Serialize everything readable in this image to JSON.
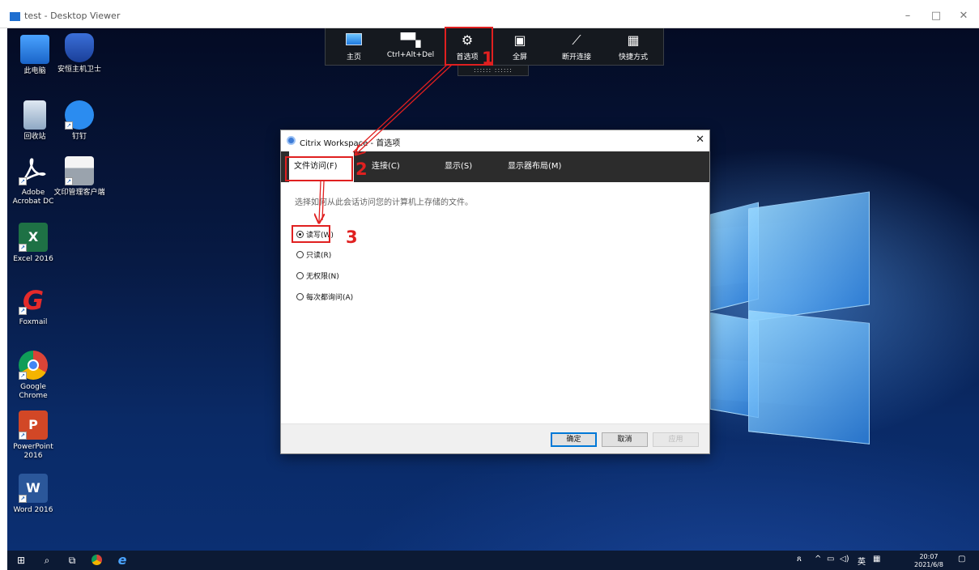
{
  "window": {
    "title": "test - Desktop Viewer",
    "controls": [
      "–",
      "□",
      "✕"
    ]
  },
  "desktop": {
    "icons": [
      {
        "label": "此电脑",
        "icon": "computer-icon"
      },
      {
        "label": "安恒主机卫士",
        "icon": "shield-icon"
      },
      {
        "label": "回收站",
        "icon": "recycle-bin-icon"
      },
      {
        "label": "钉钉",
        "icon": "dingtalk-icon"
      },
      {
        "label": "Adobe Acrobat DC",
        "icon": "acrobat-icon"
      },
      {
        "label": "文印管理客户端",
        "icon": "printer-icon"
      },
      {
        "label": "Excel 2016",
        "icon": "excel-icon"
      },
      {
        "label": "Foxmail",
        "icon": "foxmail-icon"
      },
      {
        "label": "Google Chrome",
        "icon": "chrome-icon"
      },
      {
        "label": "PowerPoint 2016",
        "icon": "powerpoint-icon"
      },
      {
        "label": "Word 2016",
        "icon": "word-icon"
      }
    ]
  },
  "toolbar": {
    "items": [
      {
        "label": "主页",
        "icon": "home-icon"
      },
      {
        "label": "Ctrl+Alt+Del",
        "icon": "ctrl-alt-del-icon"
      },
      {
        "label": "首选项",
        "icon": "gears-icon"
      },
      {
        "label": "全屏",
        "icon": "fullscreen-icon"
      },
      {
        "label": "断开连接",
        "icon": "disconnect-icon"
      },
      {
        "label": "快捷方式",
        "icon": "shortcuts-icon"
      }
    ],
    "handle": "::::::  ::::::"
  },
  "dialog": {
    "title": "Citrix Workspace - 首选项",
    "close": "✕",
    "tabs": [
      "文件访问(F)",
      "连接(C)",
      "显示(S)",
      "显示器布局(M)"
    ],
    "active_tab": "文件访问(F)",
    "description": "选择如何从此会话访问您的计算机上存储的文件。",
    "options": [
      "读写(W)",
      "只读(R)",
      "无权限(N)",
      "每次都询问(A)"
    ],
    "selected_option": "读写(W)",
    "buttons": {
      "ok": "确定",
      "cancel": "取消",
      "apply": "应用"
    }
  },
  "annotations": {
    "step1": "1",
    "step2": "2",
    "step3": "3"
  },
  "taskbar": {
    "tray_text": "英",
    "clock_time": "20:07",
    "clock_date": "2021/6/8",
    "icons": [
      "windows-start-icon",
      "search-icon",
      "task-view-icon",
      "chrome-icon",
      "ie-icon"
    ]
  },
  "colors": {
    "annotation_red": "#e02020",
    "toolbar_bg": "#15191f",
    "tabbar_bg": "#2c2c2c",
    "primary_button_border": "#0078d7"
  }
}
